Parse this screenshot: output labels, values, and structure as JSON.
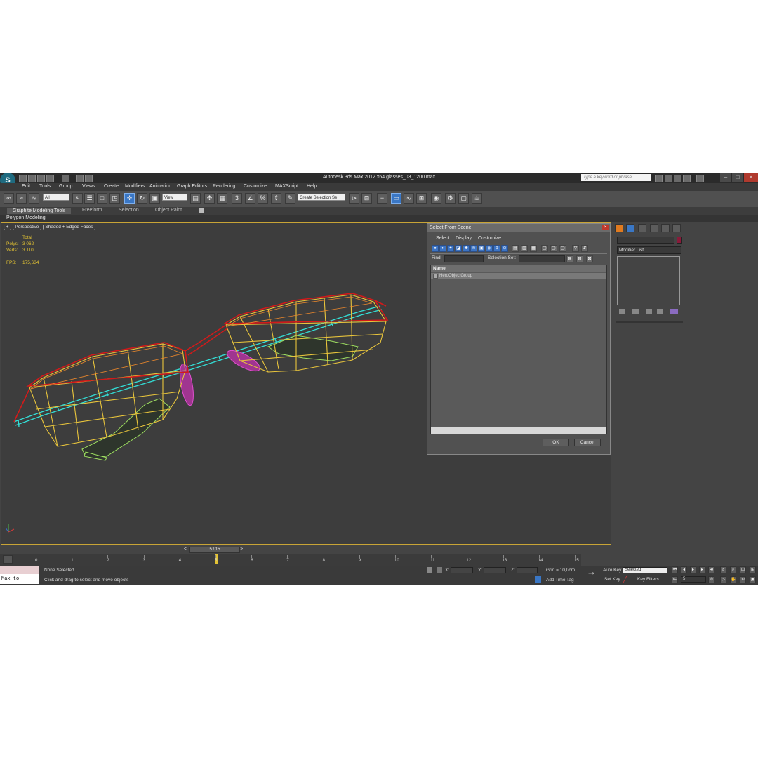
{
  "app": {
    "logo": "S",
    "title": "Autodesk 3ds Max  2012 x64      glasses_03_1200.max",
    "search_placeholder": "Type a keyword or phrase",
    "window_buttons": [
      "–",
      "□",
      "×"
    ]
  },
  "menu": [
    "Edit",
    "Tools",
    "Group",
    "Views",
    "Create",
    "Modifiers",
    "Animation",
    "Graph Editors",
    "Rendering",
    "Customize",
    "MAXScript",
    "Help"
  ],
  "toolbar": {
    "selection_filter": "All",
    "ref_coord": "View",
    "named_selection": "Create Selection Se"
  },
  "ribbon": {
    "tabs": [
      "Graphite Modeling Tools",
      "Freeform",
      "Selection",
      "Object Paint"
    ],
    "sub_tab": "Polygon Modeling"
  },
  "viewport": {
    "label": "[ + ] [ Perspective ] [ Shaded + Edged Faces ]",
    "stats": {
      "total_label": "Total",
      "polys_label": "Polys:",
      "polys_value": "3 062",
      "verts_label": "Verts:",
      "verts_value": "3 110",
      "fps_label": "FPS:",
      "fps_value": "175,634"
    }
  },
  "dialog": {
    "title": "Select From Scene",
    "close": "×",
    "menu": [
      "Select",
      "Display",
      "Customize"
    ],
    "find_label": "Find:",
    "selection_set_label": "Selection Set:",
    "column_name": "Name",
    "rows": [
      "HeroObjectGroup"
    ],
    "ok_label": "OK",
    "cancel_label": "Cancel"
  },
  "command_panel": {
    "modifier_list": "Modifier List"
  },
  "timeline": {
    "frame_display": "5 / 15",
    "prev": "<",
    "next": ">",
    "ticks": [
      "0",
      "1",
      "2",
      "3",
      "4",
      "5",
      "6",
      "7",
      "8",
      "9",
      "10",
      "11",
      "12",
      "13",
      "14",
      "15"
    ]
  },
  "status": {
    "maxscript": "Max to Physc.",
    "selection": "None Selected",
    "prompt": "Click and drag to select and move objects",
    "x_label": "X:",
    "y_label": "Y:",
    "z_label": "Z:",
    "grid": "Grid = 10,0cm",
    "add_time_tag": "Add Time Tag",
    "auto_key": "Auto Key",
    "auto_key_value": "Selected",
    "set_key": "Set Key",
    "key_filters": "Key Filters...",
    "current_frame": "5"
  },
  "colors": {
    "frame_red": "#d21a1a",
    "lens_yellow": "#e9c53c",
    "temple_cyan": "#33e0d8",
    "pad_magenta": "#d04ac0",
    "hinge_green": "#9ee060",
    "active_blue": "#3a77c5"
  }
}
